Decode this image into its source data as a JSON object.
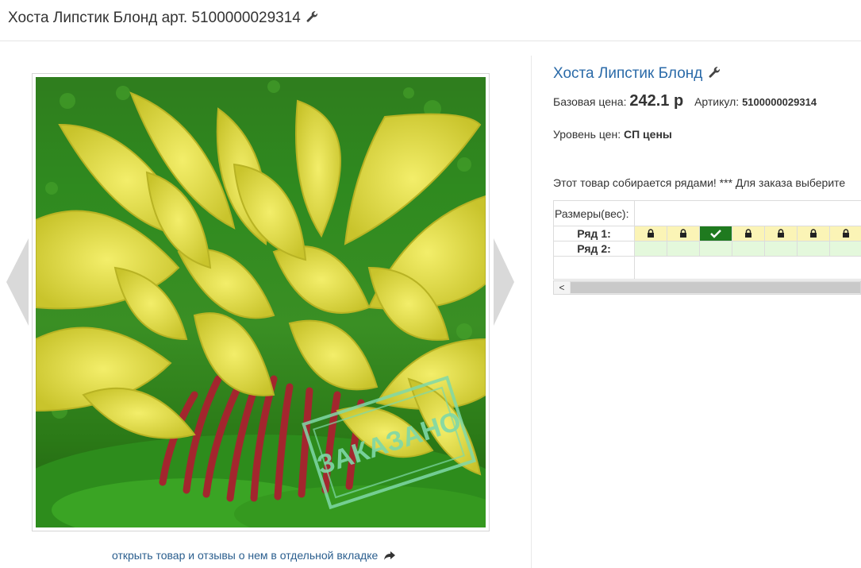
{
  "header": {
    "title": "Хоста Липстик Блонд арт. 5100000029314",
    "title_icon": "wrench-icon"
  },
  "gallery": {
    "image_alt": "Хоста Липстик Блонд",
    "stamp_text": "ЗАКАЗАНО",
    "prev_icon": "chevron-left-icon",
    "next_icon": "chevron-right-icon",
    "open_link": "открыть товар и отзывы о нем в отдельной вкладке",
    "open_link_icon": "share-arrow-icon"
  },
  "product": {
    "name": "Хоста Липстик Блонд",
    "name_icon": "wrench-icon",
    "base_price_label": "Базовая цена:",
    "base_price": "242.1 р",
    "article_label": "Артикул:",
    "article": "5100000029314",
    "price_level_label": "Уровень цен:",
    "price_level": "СП цены",
    "notice": "Этот товар собирается рядами! *** Для заказа выберите"
  },
  "rows_grid": {
    "sizes_label": "Размеры(вес):",
    "rows": [
      {
        "label": "Ряд 1:",
        "cells": [
          "locked",
          "locked",
          "selected",
          "locked",
          "locked",
          "locked",
          "locked"
        ]
      },
      {
        "label": "Ряд 2:",
        "cells": [
          "free",
          "free",
          "free",
          "free",
          "free",
          "free",
          "free"
        ]
      }
    ],
    "scroll_left": "<"
  },
  "colors": {
    "link": "#2a6aa8",
    "locked_cell": "#fbf4b6",
    "selected_cell": "#1f7a1f",
    "free_cell": "#e4f8dc",
    "stamp": "#7fd8a8"
  }
}
